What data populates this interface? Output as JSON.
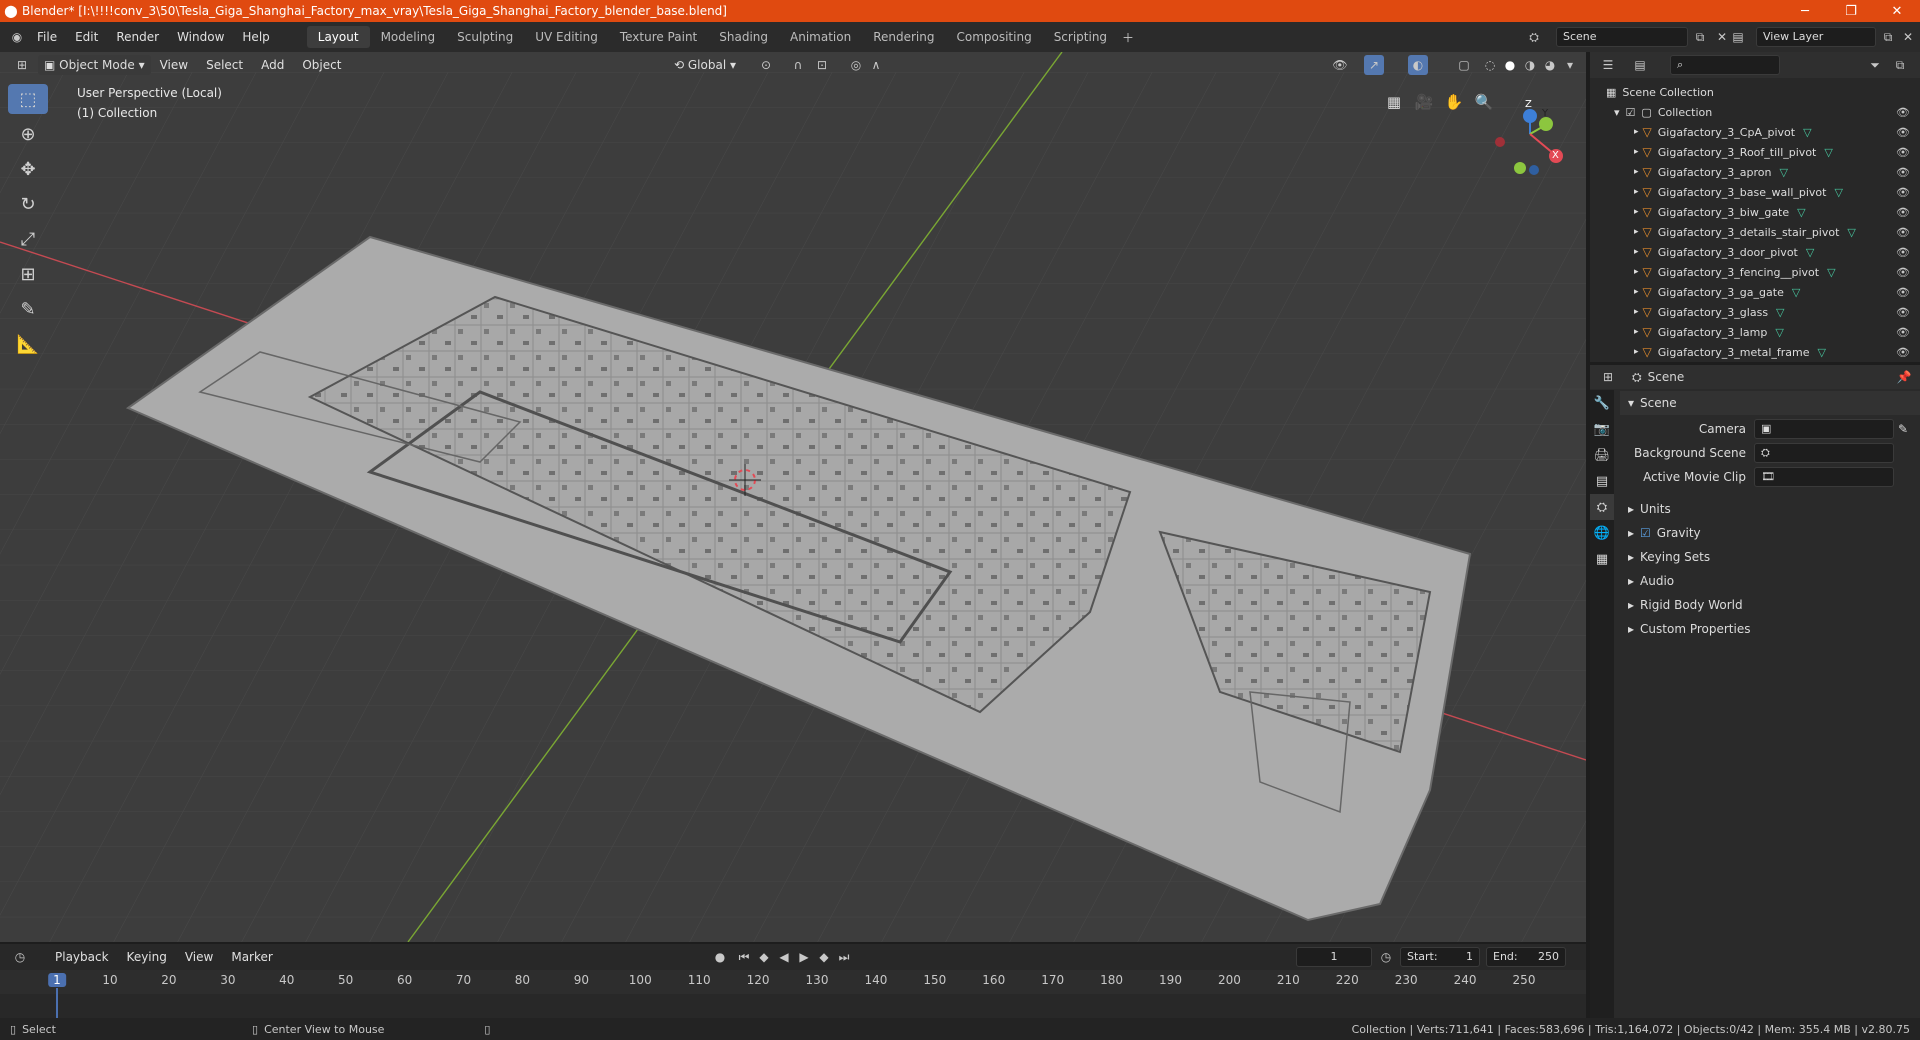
{
  "window": {
    "title": "Blender* [I:\\!!!!conv_3\\50\\Tesla_Giga_Shanghai_Factory_max_vray\\Tesla_Giga_Shanghai_Factory_blender_base.blend]"
  },
  "menu": [
    "File",
    "Edit",
    "Render",
    "Window",
    "Help"
  ],
  "workspaces": [
    {
      "label": "Layout",
      "active": true
    },
    {
      "label": "Modeling"
    },
    {
      "label": "Sculpting"
    },
    {
      "label": "UV Editing"
    },
    {
      "label": "Texture Paint"
    },
    {
      "label": "Shading"
    },
    {
      "label": "Animation"
    },
    {
      "label": "Rendering"
    },
    {
      "label": "Compositing"
    },
    {
      "label": "Scripting"
    }
  ],
  "scene_field": "Scene",
  "view_layer_field": "View Layer",
  "viewport": {
    "mode": "Object Mode",
    "menus": [
      "View",
      "Select",
      "Add",
      "Object"
    ],
    "orientation": "Global",
    "info_line1": "User Perspective (Local)",
    "info_line2": "(1) Collection",
    "axis_x": "X",
    "axis_y": "Y",
    "axis_z": "Z"
  },
  "outliner": {
    "root": "Scene Collection",
    "collection": "Collection",
    "items": [
      "Gigafactory_3_CpA_pivot",
      "Gigafactory_3_Roof_till_pivot",
      "Gigafactory_3_apron",
      "Gigafactory_3_base_wall_pivot",
      "Gigafactory_3_biw_gate",
      "Gigafactory_3_details_stair_pivot",
      "Gigafactory_3_door_pivot",
      "Gigafactory_3_fencing__pivot",
      "Gigafactory_3_ga_gate",
      "Gigafactory_3_glass",
      "Gigafactory_3_lamp",
      "Gigafactory_3_metal_frame"
    ]
  },
  "properties": {
    "header": "Scene",
    "panel": "Scene",
    "camera_label": "Camera",
    "bg_scene_label": "Background Scene",
    "movie_clip_label": "Active Movie Clip",
    "sections": [
      "Units",
      "Gravity",
      "Keying Sets",
      "Audio",
      "Rigid Body World",
      "Custom Properties"
    ],
    "gravity_checked": true
  },
  "timeline": {
    "menus": [
      "Playback",
      "Keying",
      "View",
      "Marker"
    ],
    "current_frame": "1",
    "start_label": "Start:",
    "start": "1",
    "end_label": "End:",
    "end": "250",
    "frames": [
      "1",
      "10",
      "20",
      "30",
      "40",
      "50",
      "60",
      "70",
      "80",
      "90",
      "100",
      "110",
      "120",
      "130",
      "140",
      "150",
      "160",
      "170",
      "180",
      "190",
      "200",
      "210",
      "220",
      "230",
      "240",
      "250"
    ]
  },
  "status": {
    "left": "Select",
    "middle": "Center View to Mouse",
    "right": "Collection | Verts:711,641 | Faces:583,696 | Tris:1,164,072 | Objects:0/42 | Mem: 355.4 MB | v2.80.75"
  },
  "colors": {
    "titlebar": "#e04a10",
    "accent": "#5478b0",
    "x_axis": "#e34a55",
    "y_axis": "#8cc63f",
    "z_axis": "#3d7fd8",
    "object": "#e08a2c",
    "mesh": "#48c8a0"
  }
}
